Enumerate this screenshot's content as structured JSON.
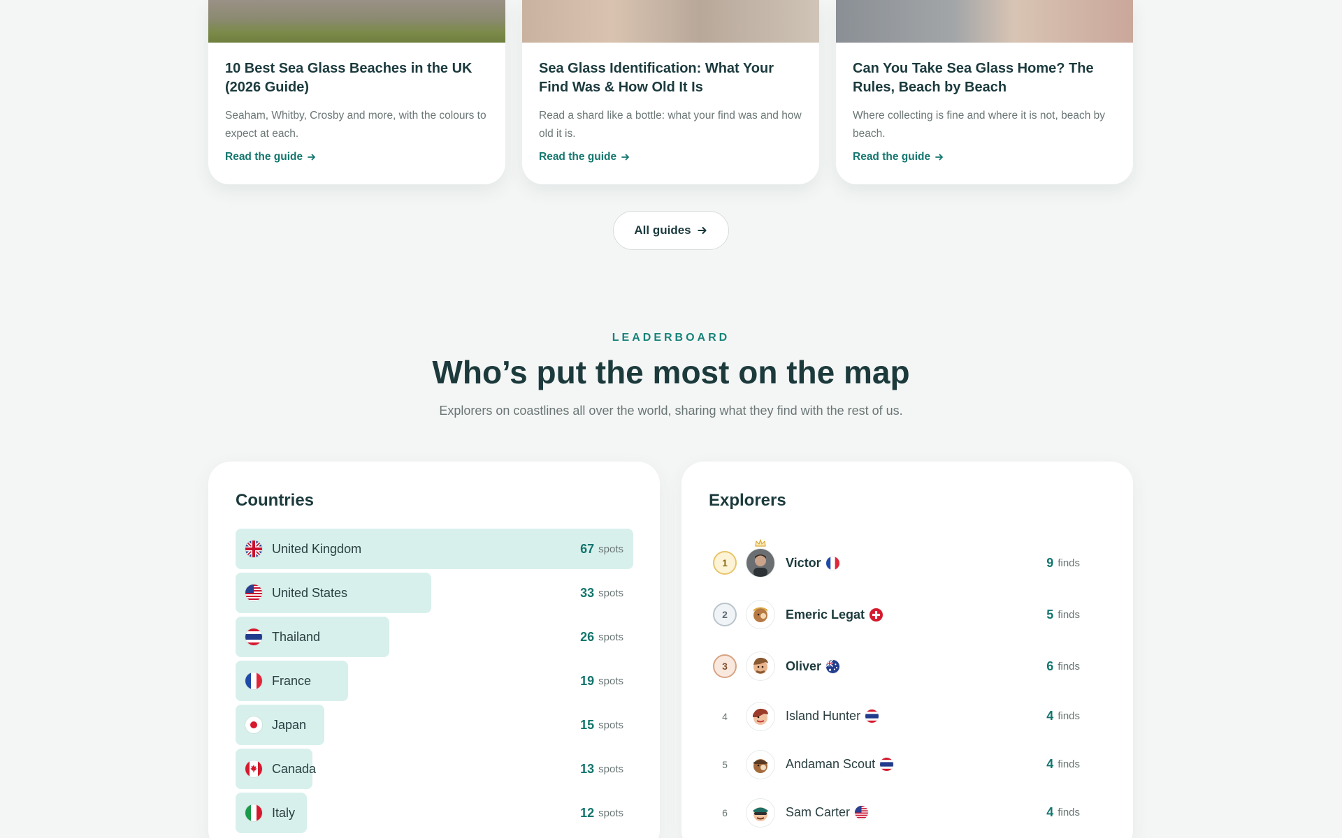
{
  "guides": [
    {
      "title": "10 Best Sea Glass Beaches in the UK (2026 Guide)",
      "description": "Seaham, Whitby, Crosby and more, with the colours to expect at each.",
      "link": "Read the guide"
    },
    {
      "title": "Sea Glass Identification: What Your Find Was & How Old It Is",
      "description": "Read a shard like a bottle: what your find was and how old it is.",
      "link": "Read the guide"
    },
    {
      "title": "Can You Take Sea Glass Home? The Rules, Beach by Beach",
      "description": "Where collecting is fine and where it is not, beach by beach.",
      "link": "Read the guide"
    }
  ],
  "all_guides_label": "All guides",
  "leaderboard": {
    "eyebrow": "LEADERBOARD",
    "title": "Who’s put the most on the map",
    "subtitle": "Explorers on coastlines all over the world, sharing what they find with the rest of us."
  },
  "countries": {
    "title": "Countries",
    "unit": "spots",
    "items": [
      {
        "name": "United Kingdom",
        "count": 67,
        "flag": "uk"
      },
      {
        "name": "United States",
        "count": 33,
        "flag": "us"
      },
      {
        "name": "Thailand",
        "count": 26,
        "flag": "th"
      },
      {
        "name": "France",
        "count": 19,
        "flag": "fr"
      },
      {
        "name": "Japan",
        "count": 15,
        "flag": "jp"
      },
      {
        "name": "Canada",
        "count": 13,
        "flag": "ca"
      },
      {
        "name": "Italy",
        "count": 12,
        "flag": "it"
      }
    ]
  },
  "explorers": {
    "title": "Explorers",
    "unit": "finds",
    "items": [
      {
        "rank": "1",
        "name": "Victor",
        "flag": "fr",
        "count": 9
      },
      {
        "rank": "2",
        "name": "Emeric Legat",
        "flag": "ch",
        "count": 5
      },
      {
        "rank": "3",
        "name": "Oliver",
        "flag": "au",
        "count": 6
      },
      {
        "rank": "4",
        "name": "Island Hunter",
        "flag": "th",
        "count": 4
      },
      {
        "rank": "5",
        "name": "Andaman Scout",
        "flag": "th",
        "count": 4
      },
      {
        "rank": "6",
        "name": "Sam Carter",
        "flag": "us",
        "count": 4
      }
    ]
  },
  "colors": {
    "accent": "#13766e",
    "bar": "#d8f0ec",
    "text": "#1c3a3c",
    "background": "#f4f6f5"
  },
  "icons": {
    "arrow": "arrow-right-icon",
    "crown": "crown-icon"
  }
}
